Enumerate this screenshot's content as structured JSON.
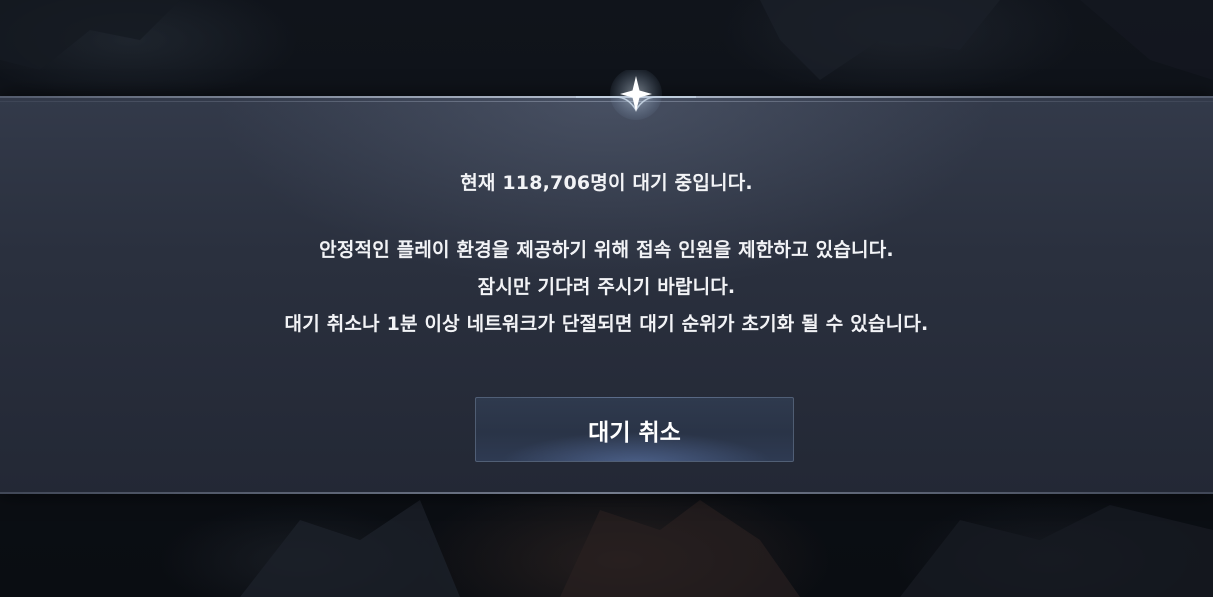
{
  "queue": {
    "line1": "현재 118,706명이 대기 중입니다.",
    "line2": "안정적인 플레이 환경을 제공하기 위해 접속 인원을 제한하고 있습니다.",
    "line3": "잠시만 기다려 주시기 바랍니다.",
    "line4": "대기 취소나 1분 이상 네트워크가 단절되면 대기 순위가 초기화 될 수 있습니다."
  },
  "buttons": {
    "cancel_label": "대기 취소"
  },
  "icons": {
    "ornament": "sparkle-star-icon"
  },
  "colors": {
    "panel": "#2a303e",
    "text": "#f2f3f6",
    "button": "#2c3649"
  }
}
